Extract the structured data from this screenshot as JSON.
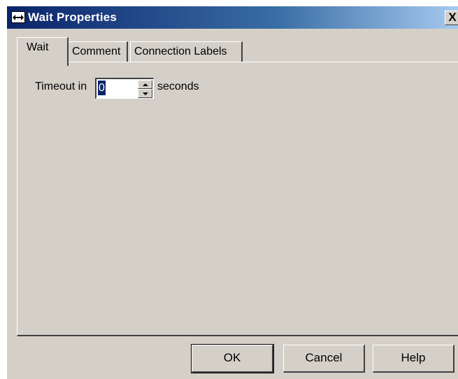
{
  "window": {
    "title": "Wait Properties",
    "close_label": "X"
  },
  "tabs": [
    {
      "label": "Wait",
      "selected": true
    },
    {
      "label": "Comment",
      "selected": false
    },
    {
      "label": "Connection Labels",
      "selected": false
    }
  ],
  "wait_tab": {
    "timeout_label": "Timeout in",
    "timeout_value": "0",
    "units_label": "seconds"
  },
  "buttons": {
    "ok": "OK",
    "cancel": "Cancel",
    "help": "Help"
  },
  "icons": {
    "window_icon": "wait-properties-icon",
    "spin_up": "spin-up-arrow-icon",
    "spin_down": "spin-down-arrow-icon"
  },
  "colors": {
    "title_bar_start": "#0a246a",
    "title_bar_end": "#a6caf0",
    "dialog_face": "#d4d0c8",
    "selection": "#0a246a"
  }
}
